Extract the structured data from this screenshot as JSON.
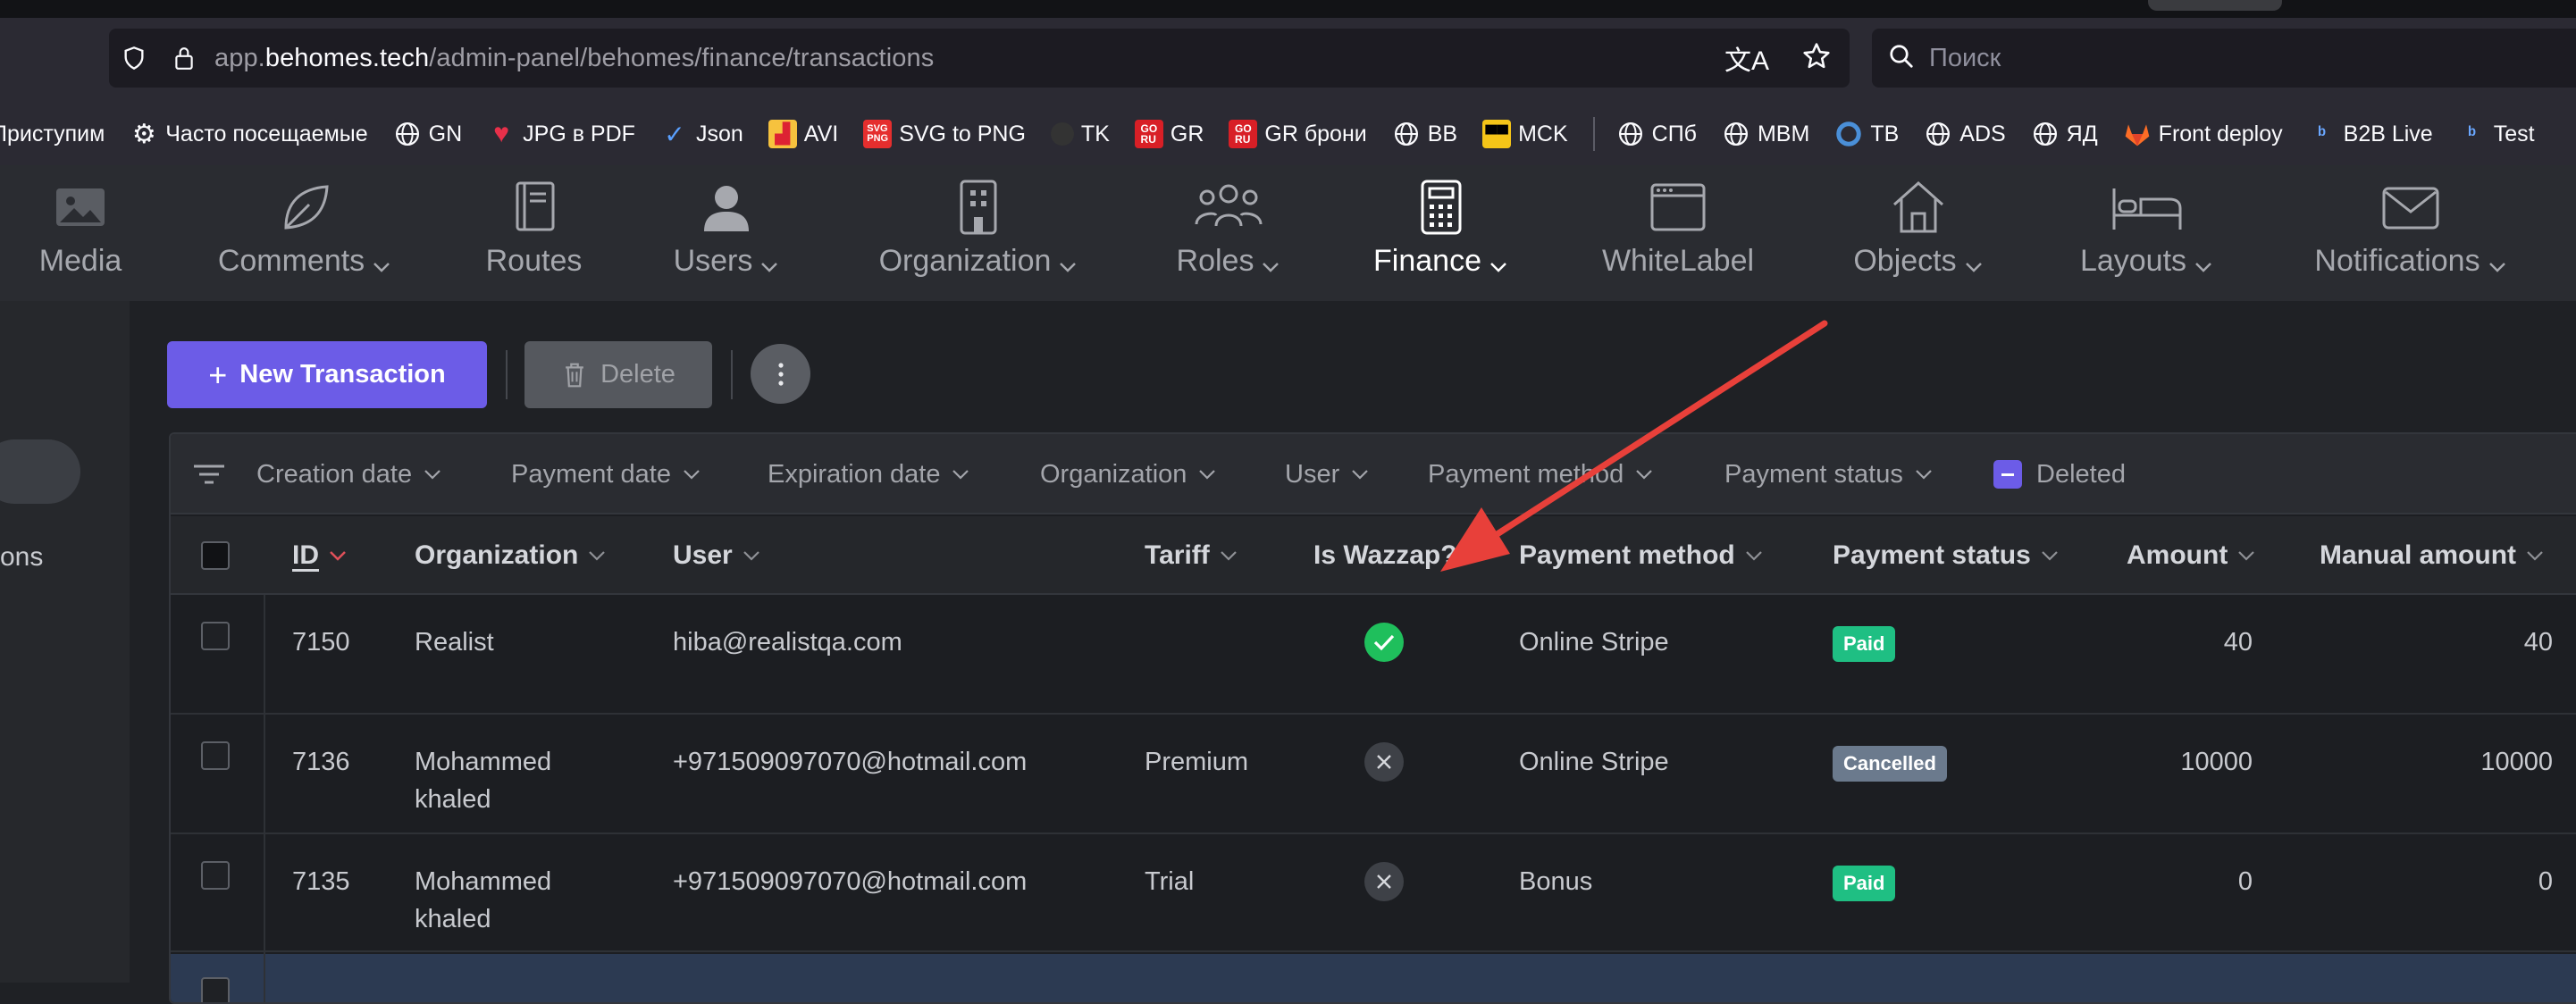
{
  "browser": {
    "url_prefix": "app.",
    "url_domain": "behomes.tech",
    "url_path": "/admin-panel/behomes/finance/transactions",
    "search_placeholder": "Поиск"
  },
  "bookmarks": [
    {
      "label": "Приступим",
      "icon": "none"
    },
    {
      "label": "Часто посещаемые",
      "icon": "gear-icon"
    },
    {
      "label": "GN",
      "icon": "globe-icon"
    },
    {
      "label": "JPG в PDF",
      "icon": "heart-icon"
    },
    {
      "label": "Json",
      "icon": "check-icon"
    },
    {
      "label": "AVI",
      "icon": "chart-icon"
    },
    {
      "label": "SVG to PNG",
      "icon": "svg-icon"
    },
    {
      "label": "TK",
      "icon": "dark-icon"
    },
    {
      "label": "GR",
      "icon": "go-icon"
    },
    {
      "label": "GR брони",
      "icon": "go-icon"
    },
    {
      "label": "BB",
      "icon": "globe-icon"
    },
    {
      "label": "MCK",
      "icon": "yellow-icon"
    },
    {
      "label": "СПб",
      "icon": "globe-icon"
    },
    {
      "label": "MBM",
      "icon": "globe-icon"
    },
    {
      "label": "TB",
      "icon": "tb-icon"
    },
    {
      "label": "ADS",
      "icon": "globe-icon"
    },
    {
      "label": "ЯД",
      "icon": "globe-icon"
    },
    {
      "label": "Front deploy",
      "icon": "gitlab-icon"
    },
    {
      "label": "B2B Live",
      "icon": "b-icon"
    },
    {
      "label": "Test",
      "icon": "b-icon"
    }
  ],
  "nav": {
    "media": "Media",
    "comments": "Comments",
    "routes": "Routes",
    "users": "Users",
    "organization": "Organization",
    "roles": "Roles",
    "finance": "Finance",
    "whitelabel": "WhiteLabel",
    "objects": "Objects",
    "layouts": "Layouts",
    "notifications": "Notifications"
  },
  "sidebar": {
    "partial_label": "ons"
  },
  "toolbar": {
    "new_label": "New Transaction",
    "delete_label": "Delete"
  },
  "filters": {
    "creation_date": "Creation date",
    "payment_date": "Payment date",
    "expiration_date": "Expiration date",
    "organization": "Organization",
    "user": "User",
    "payment_method": "Payment method",
    "payment_status": "Payment status",
    "deleted": "Deleted"
  },
  "columns": {
    "id": "ID",
    "organization": "Organization",
    "user": "User",
    "tariff": "Tariff",
    "is_wazzap": "Is Wazzap?",
    "payment_method": "Payment method",
    "payment_status": "Payment status",
    "amount": "Amount",
    "manual_amount": "Manual amount"
  },
  "rows": [
    {
      "id": "7150",
      "org1": "Realist",
      "org2": "",
      "user": "hiba@realistqa.com",
      "tariff": "",
      "wazzap": true,
      "method": "Online Stripe",
      "status": "Paid",
      "amount": "40",
      "manual": "40"
    },
    {
      "id": "7136",
      "org1": "Mohammed",
      "org2": "khaled",
      "user": "+971509097070@hotmail.com",
      "tariff": "Premium",
      "wazzap": false,
      "method": "Online Stripe",
      "status": "Cancelled",
      "amount": "10000",
      "manual": "10000"
    },
    {
      "id": "7135",
      "org1": "Mohammed",
      "org2": "khaled",
      "user": "+971509097070@hotmail.com",
      "tariff": "Trial",
      "wazzap": false,
      "method": "Bonus",
      "status": "Paid",
      "amount": "0",
      "manual": "0"
    }
  ]
}
